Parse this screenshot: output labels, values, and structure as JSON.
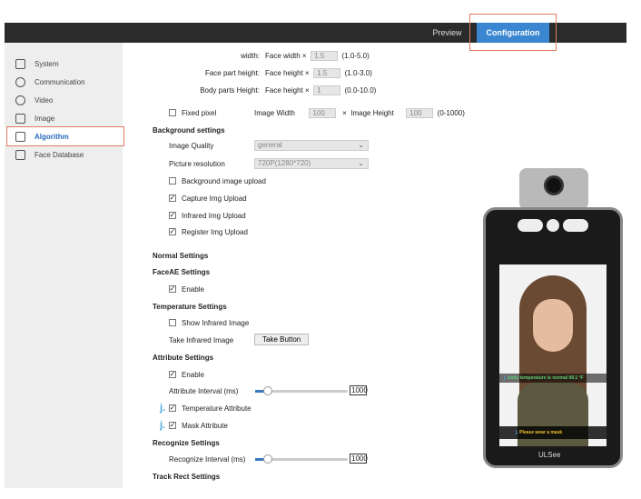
{
  "header": {
    "tabs": [
      {
        "label": "Preview"
      },
      {
        "label": "Configuration",
        "active": true
      }
    ],
    "accent": "#3a86d0"
  },
  "sidebar": {
    "items": [
      {
        "label": "System",
        "icon": "window-icon"
      },
      {
        "label": "Communication",
        "icon": "globe-icon"
      },
      {
        "label": "Video",
        "icon": "camera-icon"
      },
      {
        "label": "Image",
        "icon": "image-icon"
      },
      {
        "label": "Algorithm",
        "icon": "algorithm-icon",
        "active": true
      },
      {
        "label": "Face Database",
        "icon": "face-frame-icon"
      }
    ]
  },
  "form": {
    "width": {
      "label": "width:",
      "prefix": "Face width",
      "times": "×",
      "value": "1.5",
      "range": "(1.0-5.0)"
    },
    "face_part": {
      "label": "Face part height:",
      "prefix": "Face height",
      "times": "×",
      "value": "1.5",
      "range": "(1.0-3.0)"
    },
    "body_parts": {
      "label": "Body parts Height:",
      "prefix": "Face height",
      "times": "×",
      "value": "1",
      "range": "(0.0-10.0)"
    },
    "fixed_pixel": {
      "label": "Fixed pixel",
      "checked": false,
      "width_label": "Image Width",
      "width_value": "100",
      "times": "×",
      "height_label": "Image Height",
      "height_value": "100",
      "range": "(0-1000)"
    },
    "background": {
      "title": "Background settings",
      "quality_label": "Image Quality",
      "quality_value": "general",
      "resolution_label": "Picture resolution",
      "resolution_value": "720P(1280*720)",
      "checks": [
        {
          "label": "Background image upload",
          "checked": false
        },
        {
          "label": "Capture Img Upload",
          "checked": true
        },
        {
          "label": "Infrared Img Upload",
          "checked": true
        },
        {
          "label": "Register Img Upload",
          "checked": true
        }
      ]
    },
    "normal": {
      "title": "Normal Settings"
    },
    "faceae": {
      "title": "FaceAE Settings",
      "enable_label": "Enable",
      "enable": true
    },
    "temperature": {
      "title": "Temperature Settings",
      "show_label": "Show Infrared Image",
      "show": false,
      "take_label": "Take Infrared Image",
      "take_button": "Take Button"
    },
    "attribute": {
      "title": "Attribute Settings",
      "enable_label": "Enable",
      "enable": true,
      "interval_label": "Attribute Interval (ms)",
      "interval_value": "1000",
      "temp_label": "Temperature Attribute",
      "temp": true,
      "mask_label": "Mask Attribute",
      "mask": true,
      "marker": "j."
    },
    "recognize": {
      "title": "Recognize Settings",
      "interval_label": "Recognize Interval (ms)",
      "interval_value": "1000"
    },
    "track": {
      "title": "Track Rect Settings"
    }
  },
  "device": {
    "temp_msg": "body temperature is normal 98.1 °F",
    "mask_msg": "Please wear a mask",
    "marker": "j.",
    "brand": "ULSee"
  }
}
